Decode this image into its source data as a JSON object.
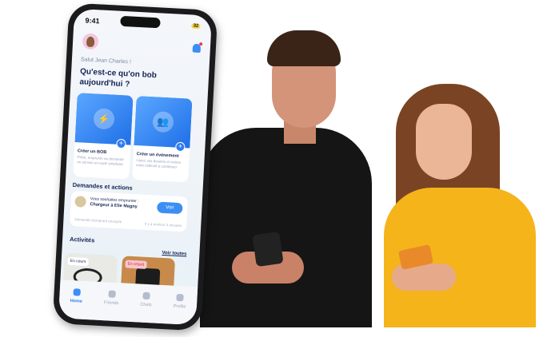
{
  "status": {
    "time": "9:41",
    "battery": "32"
  },
  "header": {
    "greeting": "Salut Jean Charles !",
    "question": "Qu'est-ce qu'on bob aujourd'hui ?"
  },
  "cards": [
    {
      "title": "Créer un BOB",
      "desc": "Prête, emprunte ou demande un service en toute simplicité"
    },
    {
      "title": "Créer un événement",
      "desc": "Listez vos besoins et invitez votre collectif à contribuer"
    }
  ],
  "requests": {
    "title": "Demandes et actions",
    "line1": "Vous souhaitez emprunter :",
    "line2": "Chargeur à Elie Magny",
    "button": "Voir",
    "footer_left": "Demande d'emprunt envoyée",
    "footer_right": "Il y a environ 3 minutes"
  },
  "activities": {
    "title": "Activités",
    "see_all": "Voir toutes",
    "items": [
      {
        "badge": "En cours"
      },
      {
        "badge": "En retard"
      }
    ]
  },
  "nav": [
    {
      "label": "Home"
    },
    {
      "label": "Friends"
    },
    {
      "label": "Chats"
    },
    {
      "label": "Profile"
    }
  ],
  "colors": {
    "accent": "#3d8ef4",
    "navy": "#142454",
    "late": "#f6c6cc"
  }
}
